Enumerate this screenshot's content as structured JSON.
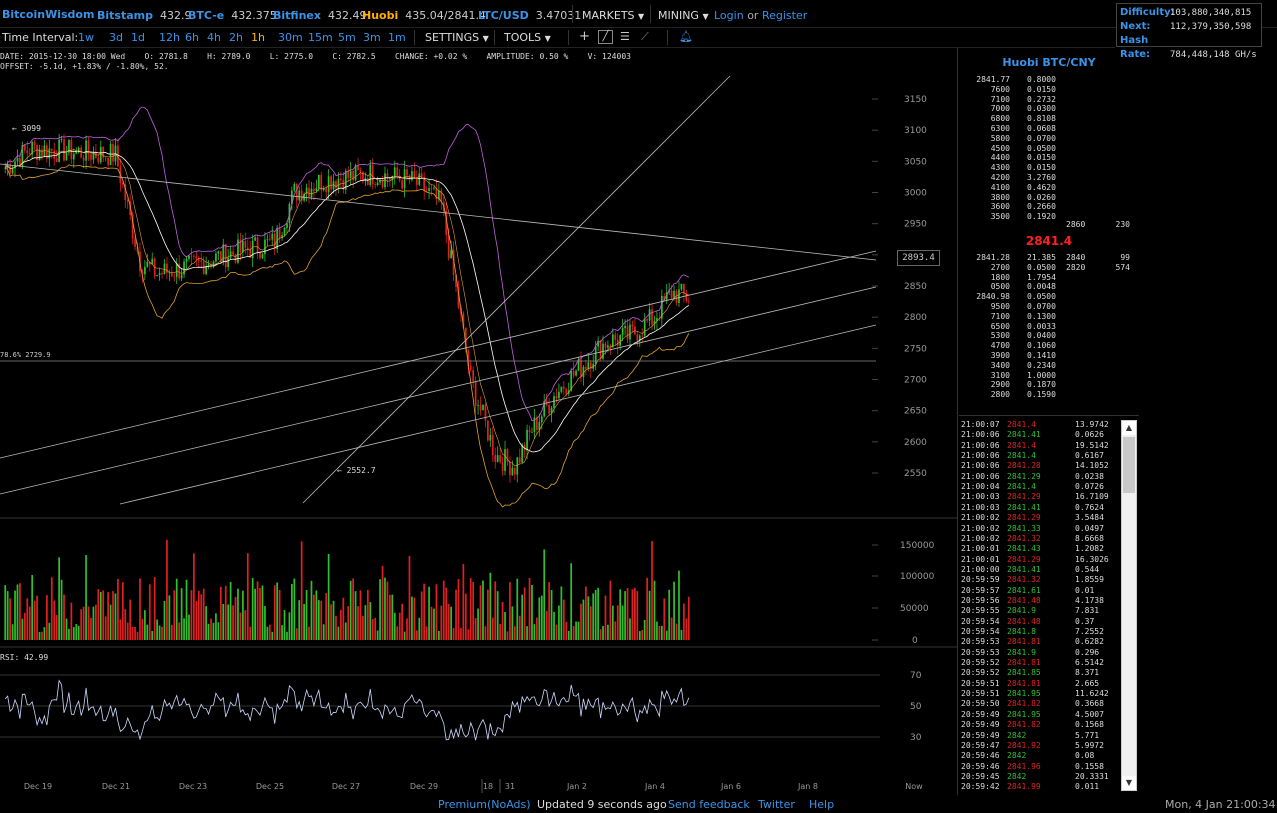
{
  "header": {
    "brand": "BitcoinWisdom",
    "exchanges": [
      {
        "name": "Bitstamp",
        "price": "432.9"
      },
      {
        "name": "BTC-e",
        "price": "432.375"
      },
      {
        "name": "Bitfinex",
        "price": "432.49"
      },
      {
        "name": "Huobi",
        "price": "435.04/2841.4"
      },
      {
        "name": "LTC/USD",
        "price": "3.47031"
      }
    ],
    "markets_label": "MARKETS",
    "mining_label": "MINING",
    "login_label": "Login",
    "or_label": "or",
    "register_label": "Register"
  },
  "network": {
    "difficulty_label": "Difficulty:",
    "difficulty_value": "103,880,340,815",
    "next_label": "Next:",
    "next_value": "112,379,350,598",
    "hashrate_label": "Hash Rate:",
    "hashrate_value": "784,448,148 GH/s"
  },
  "toolbar": {
    "time_interval_label": "Time Interval:",
    "intervals": [
      "1w",
      "3d",
      "1d",
      "12h",
      "6h",
      "4h",
      "2h",
      "1h",
      "30m",
      "15m",
      "5m",
      "3m",
      "1m"
    ],
    "active_interval": "1h",
    "settings_label": "SETTINGS",
    "tools_label": "TOOLS"
  },
  "chart_info": {
    "line1": "DATE: 2015-12-30 18:00 Wed    O: 2781.8    H: 2789.0    L: 2775.0    C: 2782.5    CHANGE: +0.02 %    AMPLITUDE: 0.50 %    V: 124003",
    "line2": "OFFSET: -5.1d, +1.83% / -1.80%, 52."
  },
  "chart_labels": {
    "high_marker": "← 3099",
    "low_marker": "← 2552.7",
    "fib_label": "78.6% 2729.9",
    "rsi_label": "RSI: 42.99",
    "now_label": "Now",
    "current_price_tag": "2893.4"
  },
  "price_axis": [
    "3150",
    "3100",
    "3050",
    "3000",
    "2950",
    "2900",
    "2850",
    "2800",
    "2750",
    "2700",
    "2650",
    "2600",
    "2550"
  ],
  "volume_axis": [
    "150000",
    "100000",
    "50000",
    "0"
  ],
  "rsi_axis": [
    "70",
    "50",
    "30"
  ],
  "date_axis": [
    "Dec 19",
    "Dec 21",
    "Dec 23",
    "Dec 25",
    "Dec 27",
    "Dec 29",
    "18",
    "31",
    "Jan 2",
    "Jan 4",
    "Jan 6",
    "Jan 8"
  ],
  "orderbook": {
    "title": "Huobi BTC/CNY",
    "asks": [
      [
        "2841.77",
        "0.8000"
      ],
      [
        "7600",
        "0.0150"
      ],
      [
        "7100",
        "0.2732"
      ],
      [
        "7000",
        "0.0300"
      ],
      [
        "6800",
        "0.8108"
      ],
      [
        "6300",
        "0.0608"
      ],
      [
        "5800",
        "0.0700"
      ],
      [
        "4500",
        "0.0500"
      ],
      [
        "4400",
        "0.0150"
      ],
      [
        "4300",
        "0.0150"
      ],
      [
        "4200",
        "3.2760"
      ],
      [
        "4100",
        "0.4620"
      ],
      [
        "3800",
        "0.0260"
      ],
      [
        "3600",
        "0.2660"
      ],
      [
        "3500",
        "0.1920"
      ]
    ],
    "ask_side_price": "2860",
    "ask_side_vol": "230",
    "last_price": "2841.4",
    "bids": [
      [
        "2841.28",
        "21.385"
      ],
      [
        "2700",
        "0.0500"
      ],
      [
        "1800",
        "1.7954"
      ],
      [
        "0500",
        "0.0048"
      ],
      [
        "2840.98",
        "0.0500"
      ],
      [
        "9500",
        "0.0700"
      ],
      [
        "7100",
        "0.1300"
      ],
      [
        "6500",
        "0.0033"
      ],
      [
        "5300",
        "0.0400"
      ],
      [
        "4700",
        "0.1060"
      ],
      [
        "3900",
        "0.1410"
      ],
      [
        "3400",
        "0.2340"
      ],
      [
        "3100",
        "1.0000"
      ],
      [
        "2900",
        "0.1870"
      ],
      [
        "2800",
        "0.1590"
      ]
    ],
    "bid_side": [
      [
        "2840",
        "99"
      ],
      [
        "2820",
        "574"
      ]
    ]
  },
  "trades": [
    [
      "21:00:07",
      "2841.4",
      "13.9742",
      "r"
    ],
    [
      "21:00:06",
      "2841.41",
      "0.0626",
      "g"
    ],
    [
      "21:00:06",
      "2841.4",
      "19.5142",
      "r"
    ],
    [
      "21:00:06",
      "2841.4",
      "0.6167",
      "g"
    ],
    [
      "21:00:06",
      "2841.28",
      "14.1052",
      "r"
    ],
    [
      "21:00:06",
      "2841.29",
      "0.0238",
      "g"
    ],
    [
      "21:00:04",
      "2841.4",
      "0.0726",
      "g"
    ],
    [
      "21:00:03",
      "2841.29",
      "16.7109",
      "r"
    ],
    [
      "21:00:03",
      "2841.41",
      "0.7624",
      "g"
    ],
    [
      "21:00:02",
      "2841.29",
      "3.5484",
      "r"
    ],
    [
      "21:00:02",
      "2841.33",
      "0.0497",
      "g"
    ],
    [
      "21:00:02",
      "2841.32",
      "8.6668",
      "r"
    ],
    [
      "21:00:01",
      "2841.43",
      "1.2082",
      "g"
    ],
    [
      "21:00:01",
      "2841.29",
      "16.3026",
      "r"
    ],
    [
      "21:00:00",
      "2841.41",
      "0.544",
      "g"
    ],
    [
      "20:59:59",
      "2841.32",
      "1.8559",
      "r"
    ],
    [
      "20:59:57",
      "2841.61",
      "0.01",
      "g"
    ],
    [
      "20:59:56",
      "2841.48",
      "4.1738",
      "r"
    ],
    [
      "20:59:55",
      "2841.9",
      "7.831",
      "g"
    ],
    [
      "20:59:54",
      "2841.48",
      "0.37",
      "r"
    ],
    [
      "20:59:54",
      "2841.8",
      "7.2552",
      "g"
    ],
    [
      "20:59:53",
      "2841.81",
      "0.6282",
      "r"
    ],
    [
      "20:59:53",
      "2841.9",
      "0.296",
      "g"
    ],
    [
      "20:59:52",
      "2841.81",
      "6.5142",
      "r"
    ],
    [
      "20:59:52",
      "2841.85",
      "8.371",
      "g"
    ],
    [
      "20:59:51",
      "2841.81",
      "2.665",
      "r"
    ],
    [
      "20:59:51",
      "2841.95",
      "11.6242",
      "g"
    ],
    [
      "20:59:50",
      "2841.82",
      "0.3668",
      "r"
    ],
    [
      "20:59:49",
      "2841.95",
      "4.5007",
      "g"
    ],
    [
      "20:59:49",
      "2841.82",
      "0.1568",
      "r"
    ],
    [
      "20:59:49",
      "2842",
      "5.771",
      "g"
    ],
    [
      "20:59:47",
      "2841.92",
      "5.9972",
      "r"
    ],
    [
      "20:59:46",
      "2842",
      "0.08",
      "g"
    ],
    [
      "20:59:46",
      "2841.96",
      "0.1558",
      "r"
    ],
    [
      "20:59:45",
      "2842",
      "20.3331",
      "g"
    ],
    [
      "20:59:42",
      "2841.99",
      "0.011",
      "r"
    ]
  ],
  "footer": {
    "premium": "Premium(NoAds)",
    "updated": "Updated 9 seconds ago",
    "feedback": "Send feedback",
    "twitter": "Twitter",
    "help": "Help",
    "clock": "Mon, 4 Jan 21:00:34"
  },
  "colors": {
    "accent": "#3b93e8",
    "active_interval": "#ffb000",
    "up": "#2ec02e",
    "down": "#e02020",
    "last_price": "#ff2020"
  }
}
